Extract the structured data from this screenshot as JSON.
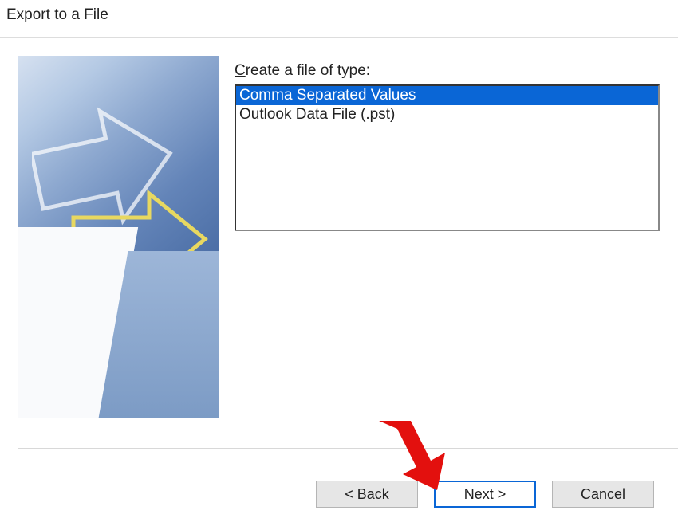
{
  "title": "Export to a File",
  "form": {
    "label_prefix": "C",
    "label_rest": "reate a file of type:",
    "options": [
      {
        "label": "Comma Separated Values",
        "selected": true
      },
      {
        "label": "Outlook Data File (.pst)",
        "selected": false
      }
    ]
  },
  "buttons": {
    "back_prefix": "< ",
    "back_ul": "B",
    "back_rest": "ack",
    "next_ul": "N",
    "next_rest": "ext >",
    "cancel": "Cancel"
  }
}
